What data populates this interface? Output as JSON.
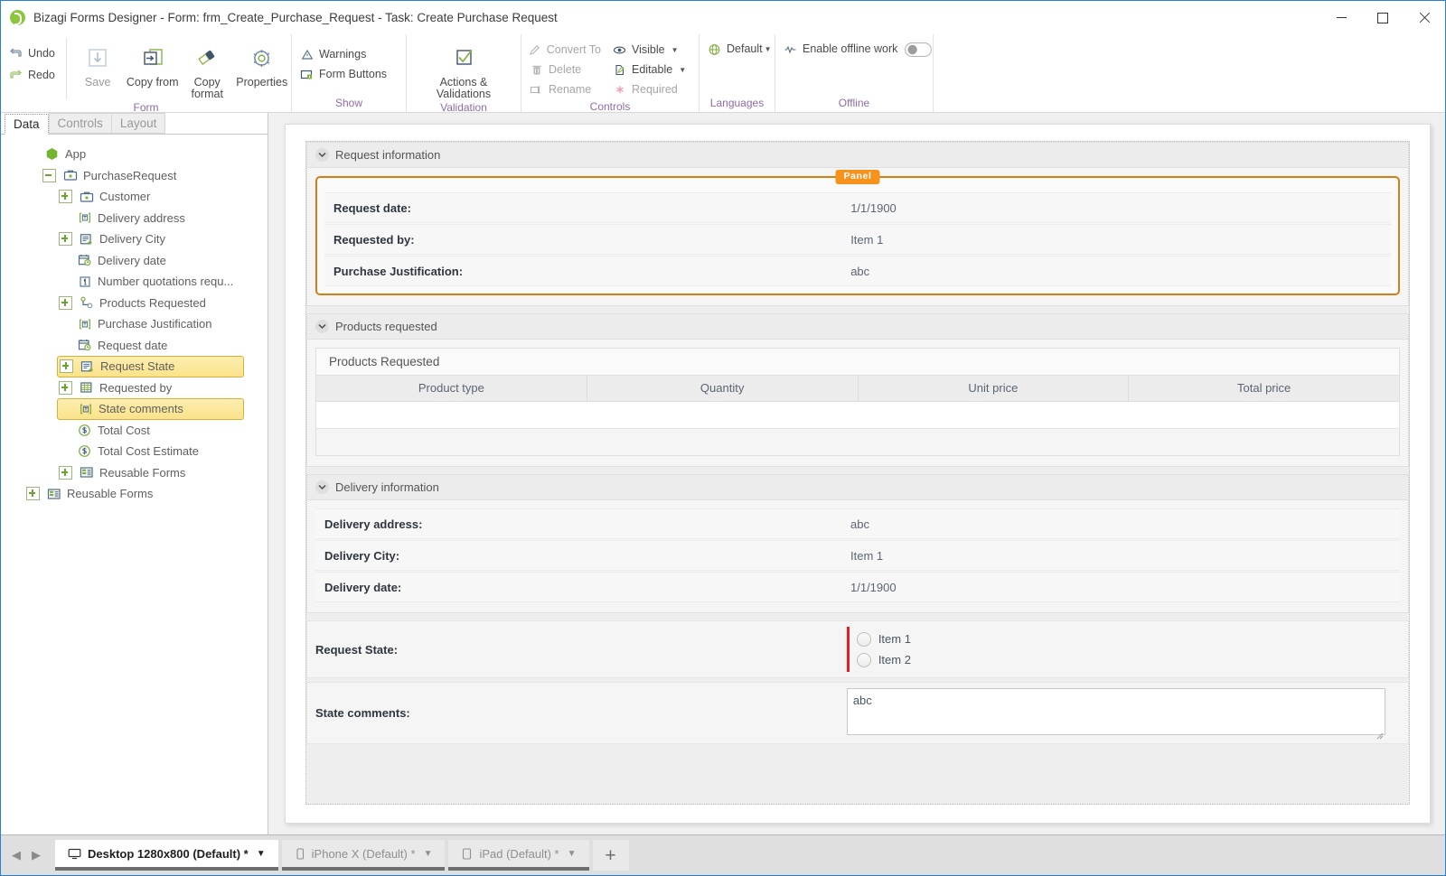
{
  "window": {
    "title": "Bizagi Forms Designer  - Form: frm_Create_Purchase_Request - Task:  Create Purchase Request",
    "app_icon": "bizagi-logo-icon",
    "minimize": "—",
    "maximize": "□",
    "close": "✕"
  },
  "ribbon": {
    "groups": [
      {
        "name": "Form",
        "label": "Form",
        "quick": [
          {
            "label": "Undo",
            "icon": "undo-icon"
          },
          {
            "label": "Redo",
            "icon": "redo-icon"
          }
        ],
        "buttons": [
          {
            "label": "Save",
            "icon": "save-icon"
          },
          {
            "label": "Copy from",
            "icon": "copy-from-icon"
          },
          {
            "label": "Copy format",
            "icon": "copy-format-icon"
          },
          {
            "label": "Properties",
            "icon": "gear-icon"
          }
        ]
      },
      {
        "name": "Show",
        "label": "Show",
        "items": [
          {
            "label": "Warnings",
            "icon": "warning-triangle-icon"
          },
          {
            "label": "Form Buttons",
            "icon": "form-buttons-icon"
          }
        ]
      },
      {
        "name": "Validation",
        "label": "Validation",
        "buttons": [
          {
            "label": "Actions & Validations",
            "icon": "checkbox-check-icon"
          }
        ]
      },
      {
        "name": "Controls",
        "label": "Controls",
        "col1": [
          {
            "label": "Convert To",
            "icon": "pencil-icon",
            "disabled": true
          },
          {
            "label": "Delete",
            "icon": "trash-icon",
            "disabled": false
          },
          {
            "label": "Rename",
            "icon": "rename-icon",
            "disabled": true
          }
        ],
        "col2": [
          {
            "label": "Visible",
            "icon": "eye-icon",
            "caret": true
          },
          {
            "label": "Editable",
            "icon": "editable-icon",
            "caret": true
          },
          {
            "label": "Required",
            "icon": "asterisk-icon",
            "caret": false,
            "disabled": true
          }
        ]
      },
      {
        "name": "Languages",
        "label": "Languages",
        "items": [
          {
            "label": "Default",
            "icon": "globe-icon",
            "caret": true
          }
        ]
      },
      {
        "name": "Offline",
        "label": "Offline",
        "toggle": {
          "label": "Enable offline work",
          "icon": "offline-icon",
          "state": "off"
        }
      }
    ]
  },
  "left_panel": {
    "tabs": [
      {
        "label": "Data",
        "active": true
      },
      {
        "label": "Controls",
        "active": false
      },
      {
        "label": "Layout",
        "active": false
      }
    ],
    "tree": [
      {
        "label": "App",
        "indent": 0,
        "expander": "none",
        "icon": "app-hex-icon",
        "selected": false
      },
      {
        "label": "PurchaseRequest",
        "indent": 1,
        "expander": "minus",
        "icon": "entity-icon",
        "selected": false
      },
      {
        "label": "Customer",
        "indent": 2,
        "expander": "plus",
        "icon": "entity-icon",
        "selected": false
      },
      {
        "label": "Delivery address",
        "indent": 2,
        "expander": "none",
        "icon": "text-field-icon",
        "selected": false
      },
      {
        "label": "Delivery City",
        "indent": 2,
        "expander": "plus",
        "icon": "list-add-icon",
        "selected": false
      },
      {
        "label": "Delivery date",
        "indent": 2,
        "expander": "none",
        "icon": "calendar-clock-icon",
        "selected": false
      },
      {
        "label": "Number quotations requ...",
        "indent": 2,
        "expander": "none",
        "icon": "number-field-icon",
        "selected": false
      },
      {
        "label": "Products Requested",
        "indent": 2,
        "expander": "plus",
        "icon": "collection-icon",
        "selected": false
      },
      {
        "label": "Purchase Justification",
        "indent": 2,
        "expander": "none",
        "icon": "text-field-icon",
        "selected": false
      },
      {
        "label": "Request date",
        "indent": 2,
        "expander": "none",
        "icon": "calendar-clock-icon",
        "selected": false
      },
      {
        "label": "Request State",
        "indent": 2,
        "expander": "plus",
        "icon": "list-add-icon",
        "selected": true
      },
      {
        "label": "Requested by",
        "indent": 2,
        "expander": "plus",
        "icon": "table-icon",
        "selected": false
      },
      {
        "label": "State comments",
        "indent": 2,
        "expander": "none",
        "icon": "text-field-icon",
        "selected": true
      },
      {
        "label": "Total Cost",
        "indent": 2,
        "expander": "none",
        "icon": "currency-icon",
        "selected": false
      },
      {
        "label": "Total Cost Estimate",
        "indent": 2,
        "expander": "none",
        "icon": "currency-icon",
        "selected": false
      },
      {
        "label": "Reusable Forms",
        "indent": 2,
        "expander": "plus",
        "icon": "reusable-forms-icon",
        "selected": false
      },
      {
        "label": "Reusable Forms",
        "indent": 0,
        "expander": "plus",
        "icon": "reusable-forms-icon",
        "selected": false
      }
    ]
  },
  "form": {
    "sections": [
      {
        "id": "request-information",
        "title": "Request information",
        "panel_tag": "Panel",
        "rows": [
          {
            "label": "Request date:",
            "value": "1/1/1900"
          },
          {
            "label": "Requested by:",
            "value": "Item 1"
          },
          {
            "label": "Purchase Justification:",
            "value": "abc"
          }
        ]
      },
      {
        "id": "products-requested",
        "title": "Products requested",
        "grid": {
          "title": "Products Requested",
          "columns": [
            "Product type",
            "Quantity",
            "Unit price",
            "Total price"
          ],
          "rows": []
        }
      },
      {
        "id": "delivery-information",
        "title": "Delivery information",
        "rows": [
          {
            "label": "Delivery address:",
            "value": "abc"
          },
          {
            "label": "Delivery City:",
            "value": "Item 1"
          },
          {
            "label": "Delivery date:",
            "value": "1/1/1900"
          }
        ]
      }
    ],
    "request_state": {
      "label": "Request State:",
      "options": [
        {
          "label": "Item 1",
          "selected": false
        },
        {
          "label": "Item 2",
          "selected": false
        }
      ],
      "marker_color": "#e31e24"
    },
    "state_comments": {
      "label": "State comments:",
      "value": "abc"
    }
  },
  "bottom_bar": {
    "prev_label": "◀",
    "next_label": "▶",
    "device_tabs": [
      {
        "label": "Desktop 1280x800 (Default) *",
        "icon": "desktop-icon",
        "active": true
      },
      {
        "label": "iPhone X (Default) *",
        "icon": "phone-icon",
        "active": false
      },
      {
        "label": "iPad (Default) *",
        "icon": "tablet-icon",
        "active": false
      }
    ],
    "add_label": "+"
  },
  "colors": {
    "accent_blue": "#2a7fd4",
    "brand_green": "#8cc63e",
    "panel_orange": "#f7931d",
    "required_red": "#e31e24",
    "group_label_purple": "#8e6ba8",
    "selection_yellow": "#fbe38a"
  }
}
